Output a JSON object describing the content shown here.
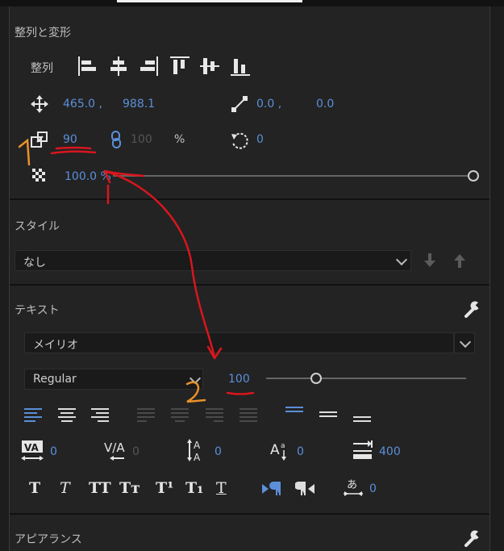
{
  "transform": {
    "title": "整列と変形",
    "align_label": "整列",
    "position_x": "465.0 ,",
    "position_y": "988.1",
    "anchor_x": "0.0 ,",
    "anchor_y": "0.0",
    "scale": "90",
    "scale_linked": "100",
    "scale_unit": "%",
    "rotation": "0",
    "opacity": "100.0 %"
  },
  "style": {
    "title": "スタイル",
    "selected": "なし"
  },
  "text": {
    "title": "テキスト",
    "font": "メイリオ",
    "font_style": "Regular",
    "font_size": "100",
    "kerning": "0",
    "tracking": "0",
    "leading": "0",
    "baseline": "0",
    "tab_width": "400",
    "tsume": "0",
    "format_buttons": [
      "T",
      "T",
      "TT",
      "Tт",
      "T¹",
      "T₁",
      "T"
    ]
  },
  "appearance": {
    "title": "アピアランス"
  },
  "annotations": {
    "label_1": "1",
    "label_2": "2"
  },
  "colors": {
    "accent": "#5b8fd9",
    "annotation_red": "#d9161d",
    "annotation_orange": "#e8912a"
  }
}
